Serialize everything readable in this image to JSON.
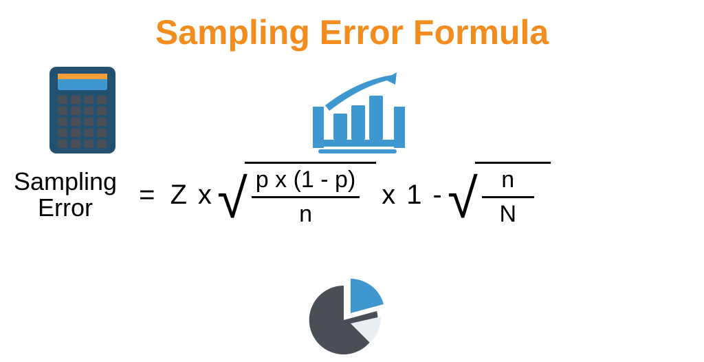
{
  "title": "Sampling Error Formula",
  "formula": {
    "label_line1": "Sampling",
    "label_line2": "Error",
    "equals": "=",
    "z": "Z",
    "times": "x",
    "frac1_num": "p x (1 - p)",
    "frac1_den": "n",
    "one": "1",
    "minus": "-",
    "frac2_num": "n",
    "frac2_den": "N"
  },
  "icons": {
    "calculator": "calculator-icon",
    "bar_growth": "bar-growth-icon",
    "pie_chart": "pie-chart-icon"
  },
  "colors": {
    "title": "#f28c1e",
    "accent_blue": "#3f97cf",
    "dark": "#4a4f55",
    "orange_strip": "#f7a03b"
  }
}
